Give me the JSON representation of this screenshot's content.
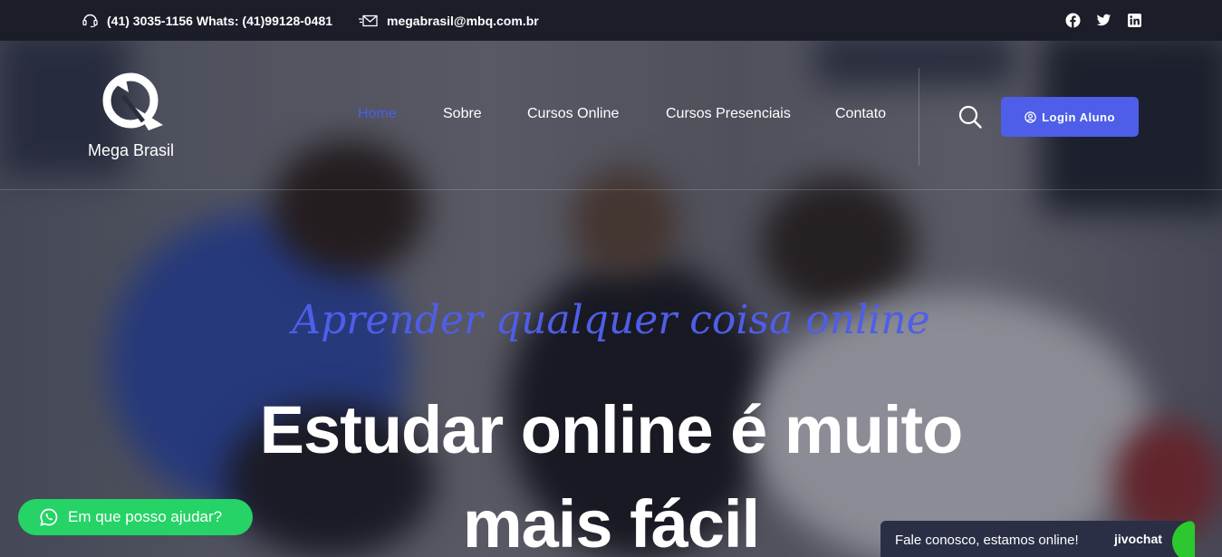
{
  "topbar": {
    "phone": "(41) 3035-1156 Whats: (41)99128-0481",
    "email": "megabrasil@mbq.com.br",
    "social": [
      "facebook-icon",
      "twitter-icon",
      "linkedin-icon"
    ]
  },
  "brand": {
    "name": "Mega Brasil"
  },
  "nav": {
    "items": [
      {
        "label": "Home",
        "active": true
      },
      {
        "label": "Sobre"
      },
      {
        "label": "Cursos Online"
      },
      {
        "label": "Cursos Presenciais"
      },
      {
        "label": "Contato"
      }
    ],
    "login_label": "Login Aluno"
  },
  "hero": {
    "tagline": "Aprender qualquer coisa online",
    "headline_line1": "Estudar online é muito",
    "headline_line2": "mais fácil"
  },
  "whatsapp": {
    "label": "Em que posso ajudar?"
  },
  "chat": {
    "message": "Fale conosco, estamos online!",
    "brand": "jivochat"
  },
  "colors": {
    "accent": "#4f5ee8",
    "topbar": "#1b1d29",
    "whatsapp": "#25d366",
    "chat_bg": "#2a2f46"
  }
}
